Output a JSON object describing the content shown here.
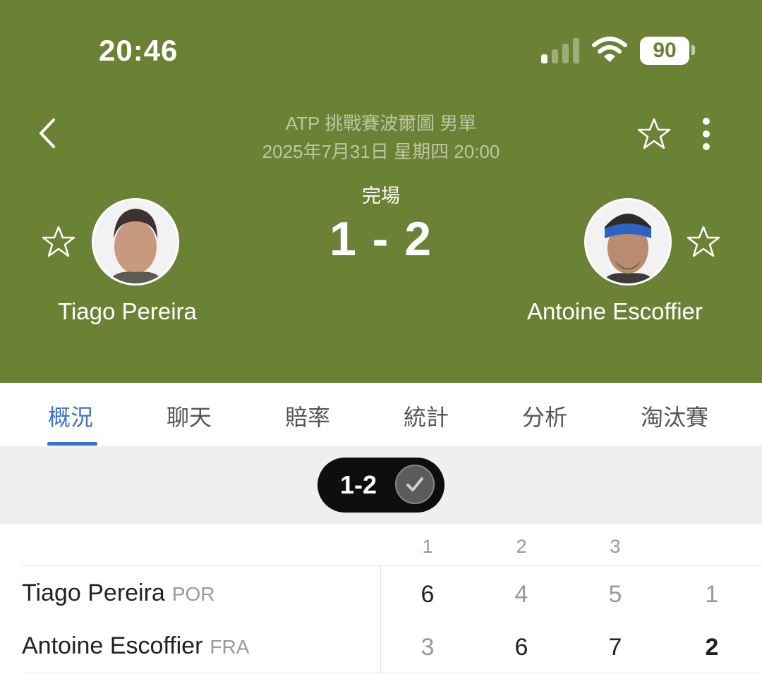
{
  "status_bar": {
    "time": "20:46",
    "battery": "90"
  },
  "match": {
    "league": "ATP 挑戰賽波爾圖 男單",
    "datetime": "2025年7月31日 星期四 20:00",
    "status": "完場",
    "score": "1 - 2"
  },
  "players": {
    "home": {
      "name": "Tiago Pereira",
      "country": "POR"
    },
    "away": {
      "name": "Antoine Escoffier",
      "country": "FRA"
    }
  },
  "tabs": [
    {
      "label": "概況"
    },
    {
      "label": "聊天"
    },
    {
      "label": "賠率"
    },
    {
      "label": "統計"
    },
    {
      "label": "分析"
    },
    {
      "label": "淘汰賽"
    }
  ],
  "result_pill": {
    "label": "1-2"
  },
  "scoreboard": {
    "set_headers": [
      "1",
      "2",
      "3"
    ],
    "rows": [
      {
        "sets": [
          "6",
          "4",
          "5"
        ],
        "total": "1"
      },
      {
        "sets": [
          "3",
          "6",
          "7"
        ],
        "total": "2"
      }
    ]
  },
  "colors": {
    "header": "#6b8133",
    "active_tab": "#3e72c8"
  },
  "icons": [
    "back-icon",
    "star-icon",
    "more-icon",
    "signal-icon",
    "wifi-icon",
    "battery-icon",
    "check-icon"
  ]
}
